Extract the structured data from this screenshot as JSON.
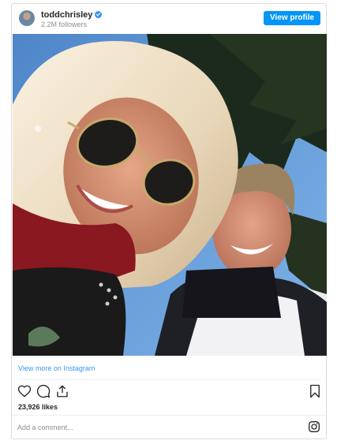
{
  "header": {
    "username": "toddchrisley",
    "verified": true,
    "followers": "2.2M followers",
    "view_profile_label": "View profile"
  },
  "post": {
    "photo_description_icon": "photo",
    "view_more_label": "View more on Instagram",
    "likes": "23,926 likes"
  },
  "actions": {
    "like_icon": "heart-icon",
    "comment_icon": "comment-icon",
    "share_icon": "share-icon",
    "save_icon": "bookmark-icon"
  },
  "comment": {
    "placeholder": "Add a comment..."
  },
  "colors": {
    "accent": "#0095f6",
    "link": "#3897f0",
    "muted": "#8e8e8e",
    "border": "#dbdbdb"
  }
}
